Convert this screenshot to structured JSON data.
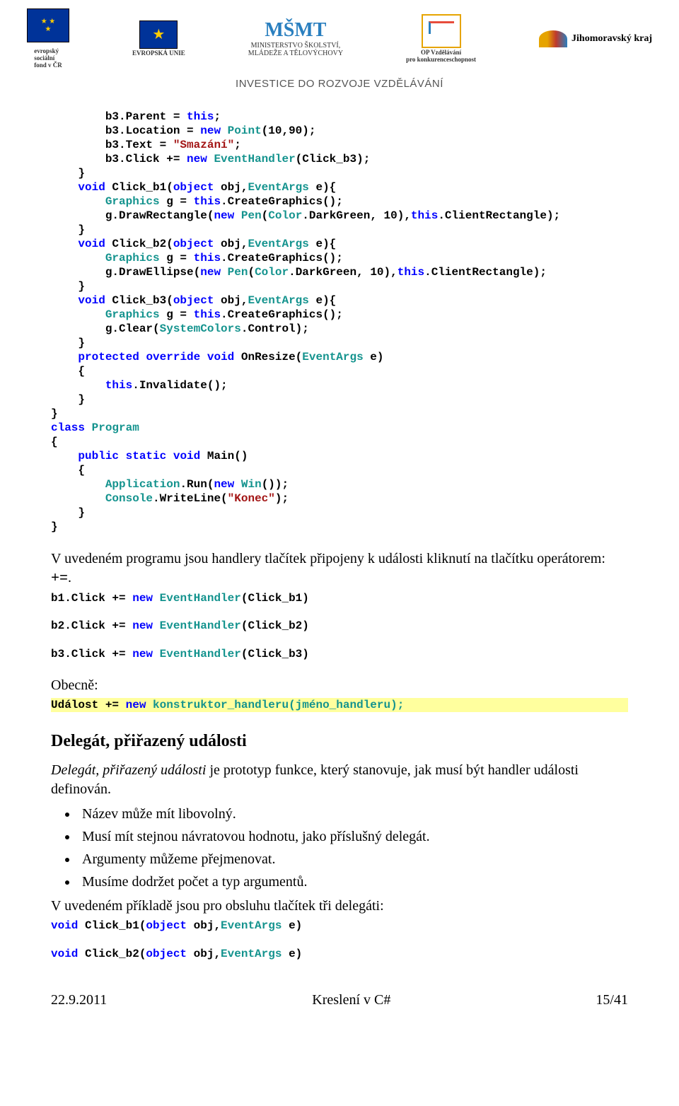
{
  "banner": {
    "esf_l1": "evropský",
    "esf_l2": "sociální",
    "esf_l3": "fond v ČR",
    "eu": "EVROPSKÁ UNIE",
    "msmt_mark": "MŠMT",
    "msmt_l1": "MINISTERSTVO ŠKOLSTVÍ,",
    "msmt_l2": "MLÁDEŽE A TĚLOVÝCHOVY",
    "opvk_l1": "OP Vzdělávání",
    "opvk_l2": "pro konkurenceschopnost",
    "jmk": "Jihomoravský kraj",
    "invest": "INVESTICE DO ROZVOJE VZDĚLÁVÁNÍ"
  },
  "code_main": "        b3.Parent = <kw>this</kw>;\n        b3.Location = <kw>new</kw> <typ>Point</typ>(10,90);\n        b3.Text = <str>\"Smazání\"</str>;\n        b3.Click += <kw>new</kw> <typ>EventHandler</typ>(Click_b3);\n    }\n    <kw>void</kw> Click_b1(<kw>object</kw> obj,<typ>EventArgs</typ> e){\n        <typ>Graphics</typ> g = <kw>this</kw>.CreateGraphics();\n        g.DrawRectangle(<kw>new</kw> <typ>Pen</typ>(<typ>Color</typ>.DarkGreen, 10),<kw>this</kw>.ClientRectangle);\n    }\n    <kw>void</kw> Click_b2(<kw>object</kw> obj,<typ>EventArgs</typ> e){\n        <typ>Graphics</typ> g = <kw>this</kw>.CreateGraphics();\n        g.DrawEllipse(<kw>new</kw> <typ>Pen</typ>(<typ>Color</typ>.DarkGreen, 10),<kw>this</kw>.ClientRectangle);\n    }\n    <kw>void</kw> Click_b3(<kw>object</kw> obj,<typ>EventArgs</typ> e){\n        <typ>Graphics</typ> g = <kw>this</kw>.CreateGraphics();\n        g.Clear(<typ>SystemColors</typ>.Control);\n    }\n    <kw>protected</kw> <kw>override</kw> <kw>void</kw> OnResize(<typ>EventArgs</typ> e)\n    {\n        <kw>this</kw>.Invalidate();\n    }\n}\n<kw>class</kw> <typ>Program</typ>\n{\n    <kw>public</kw> <kw>static</kw> <kw>void</kw> Main()\n    {\n        <typ>Application</typ>.Run(<kw>new</kw> <typ>Win</typ>());\n        <typ>Console</typ>.WriteLine(<str>\"Konec\"</str>);\n    }\n}",
  "para1_a": "V uvedeném programu jsou handlery tlačítek připojeny k události kliknutí na tlačítku operátorem: ",
  "para1_b": "+=",
  "para1_c": ".",
  "snip1": "b1.Click += <kw>new</kw> <typ>EventHandler</typ>(Click_b1)",
  "snip2": "b2.Click += <kw>new</kw> <typ>EventHandler</typ>(Click_b2)",
  "snip3": "b3.Click += <kw>new</kw> <typ>EventHandler</typ>(Click_b3)",
  "label_general": "Obecně:",
  "hl_a": "Událost ",
  "hl_b": "+= ",
  "hl_c": "new",
  "hl_d": " konstruktor_handleru(jméno_handleru);",
  "h2": "Delegát, přiřazený události",
  "para2_em": "Delegát, přiřazený události",
  "para2_rest": " je prototyp funkce, který stanovuje, jak musí být handler události definován.",
  "bullets": [
    "Název může mít libovolný.",
    "Musí mít stejnou návratovou hodnotu, jako příslušný delegát.",
    "Argumenty můžeme přejmenovat.",
    "Musíme dodržet počet a typ argumentů."
  ],
  "para3": "V uvedeném příkladě jsou pro obsluhu tlačítek tři delegáti:",
  "del1": "<kw>void</kw> Click_b1(<kw>object</kw> obj,<typ>EventArgs</typ> e)",
  "del2": "<kw>void</kw> Click_b2(<kw>object</kw> obj,<typ>EventArgs</typ> e)",
  "footer": {
    "left": "22.9.2011",
    "center": "Kreslení v C#",
    "right": "15/41"
  }
}
